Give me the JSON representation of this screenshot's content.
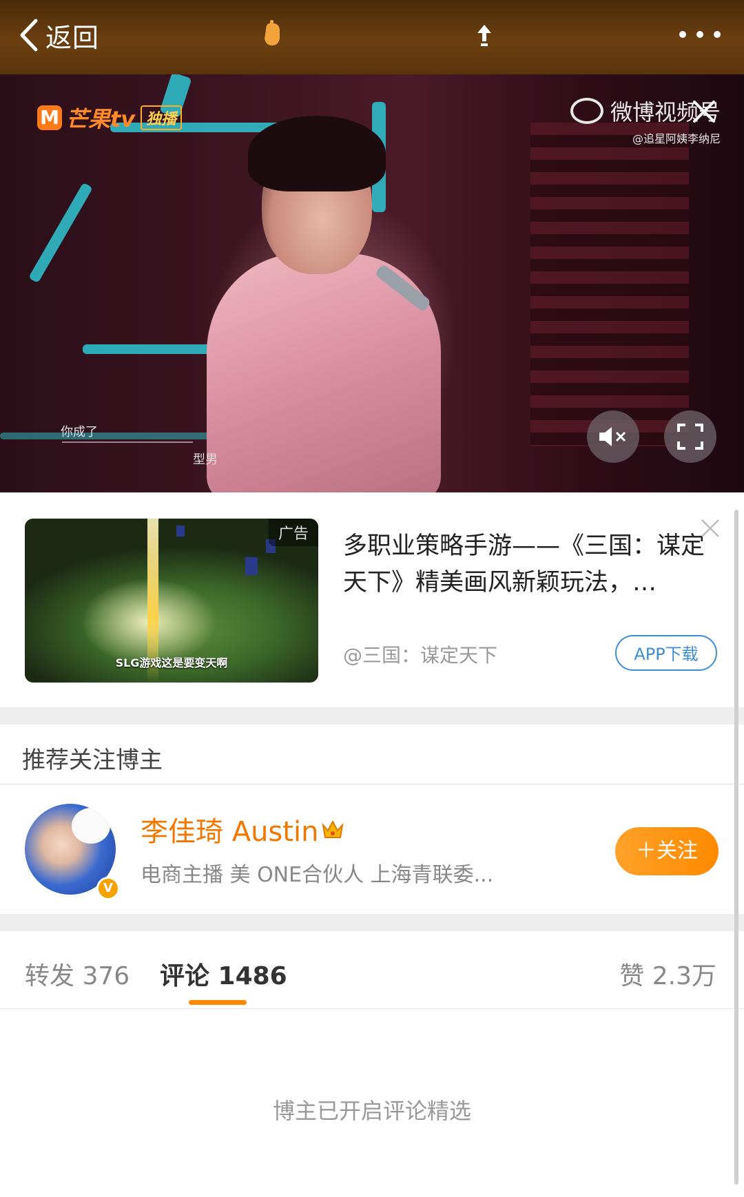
{
  "topbar": {
    "back_label": "返回",
    "icons": [
      "chevron-left-icon",
      "hand-icon",
      "share-icon",
      "more-icon"
    ]
  },
  "video": {
    "mgtv_logo_m": "M",
    "mgtv_logo_text": "芒果tv",
    "mgtv_badge": "独播",
    "weibo_line1": "微博视频号",
    "weibo_line2": "@追星阿姨李纳尼",
    "subtitle_1": "你成了",
    "subtitle_2": "型男"
  },
  "ad": {
    "label": "广告",
    "thumb_caption": "SLG游戏这是要变天啊",
    "title": "多职业策略手游——《三国：谋定天下》精美画风新颖玩法，…",
    "source": "@三国：谋定天下",
    "app_button": "APP下载"
  },
  "recommend": {
    "header": "推荐关注博主",
    "blogger": {
      "name": "李佳琦 Austin",
      "description": "电商主播 美 ONE合伙人 上海青联委...",
      "verified_badge": "V",
      "follow_label": "＋关注"
    }
  },
  "tabs": {
    "forward": "转发 376",
    "comment": "评论 1486",
    "like": "赞 2.3万"
  },
  "comment_note": "博主已开启评论精选",
  "colors": {
    "accent_orange": "#ff8a00",
    "link_blue": "#3d8ed8",
    "name_orange": "#f07800"
  }
}
